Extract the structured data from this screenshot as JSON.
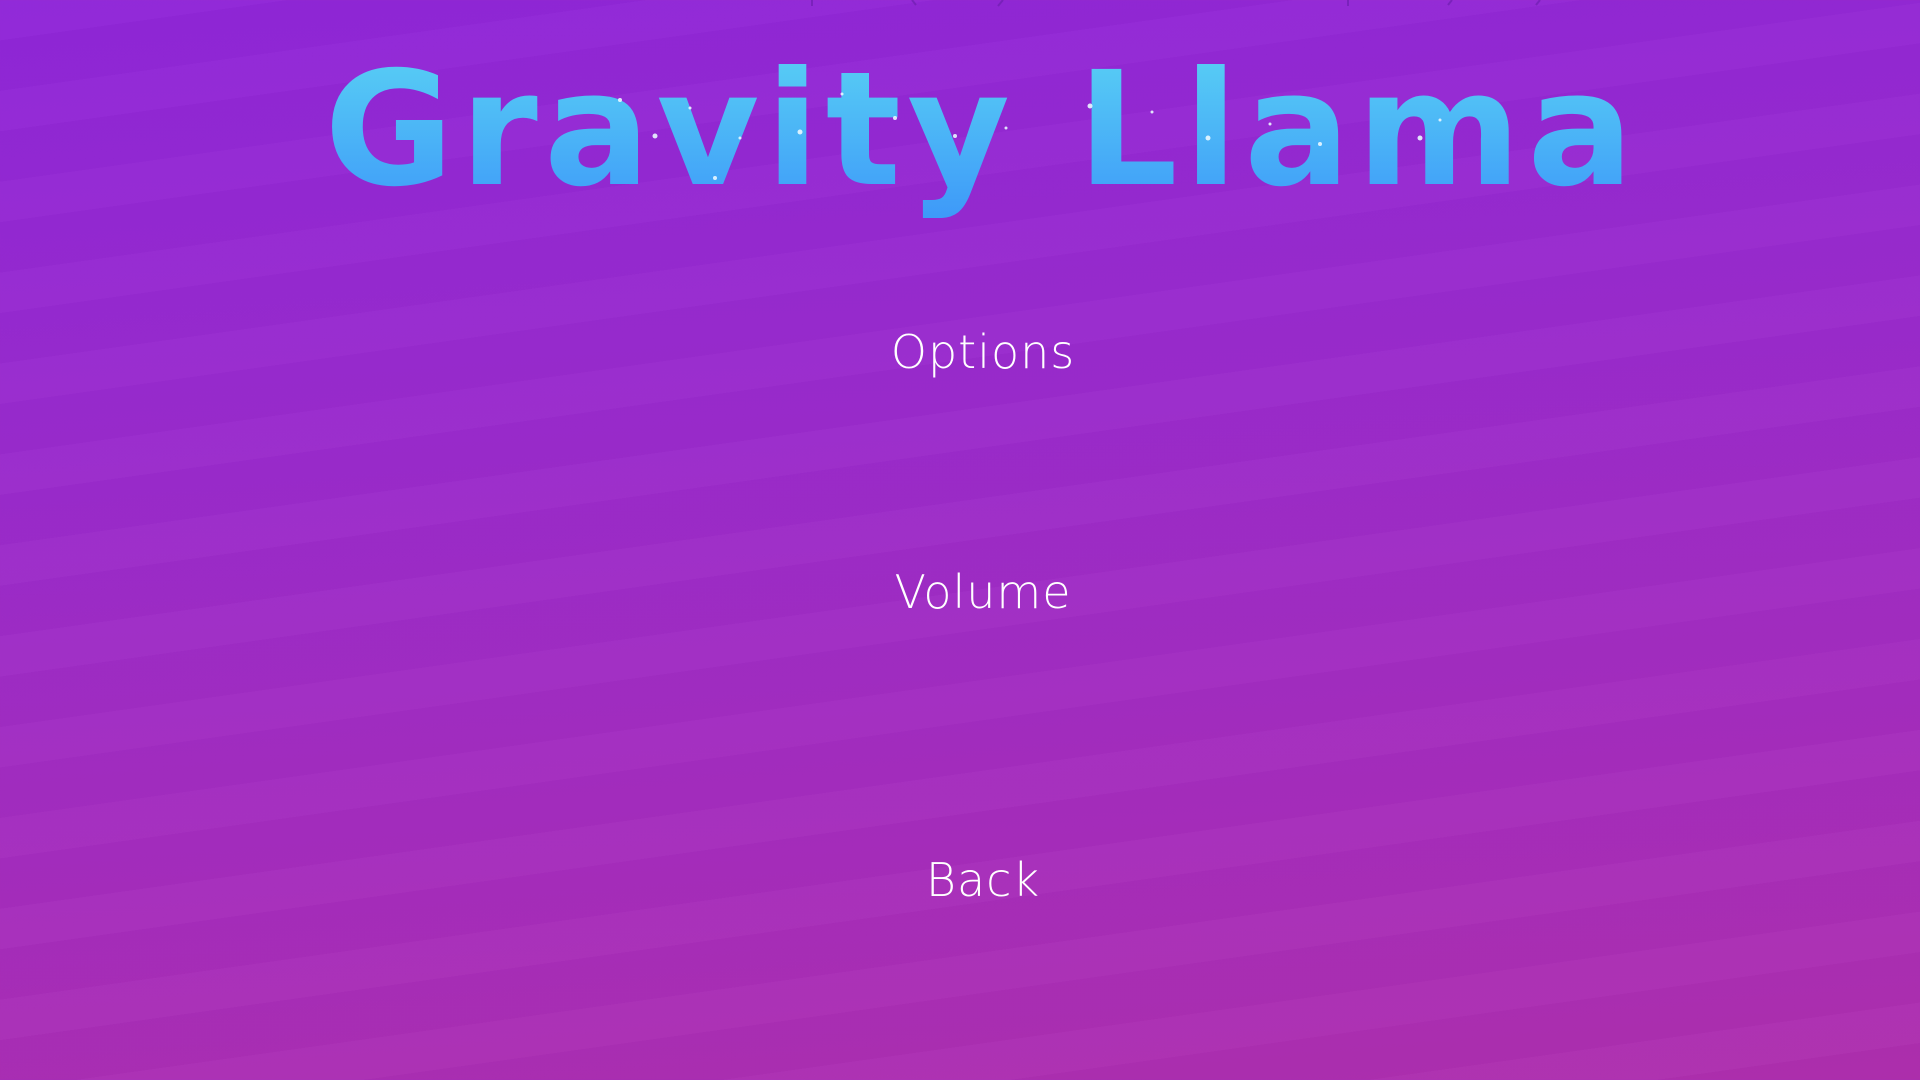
{
  "game": {
    "title": "Gravity Llama"
  },
  "menu": {
    "heading": "Options",
    "items": [
      {
        "label": "Volume"
      },
      {
        "label": "Back"
      }
    ]
  },
  "colors": {
    "background_top": "#8f26d8",
    "background_bottom": "#ae2fad",
    "title_top": "#5ad0f5",
    "title_bottom": "#3f9cf8",
    "menu_text": "#ffffff"
  }
}
